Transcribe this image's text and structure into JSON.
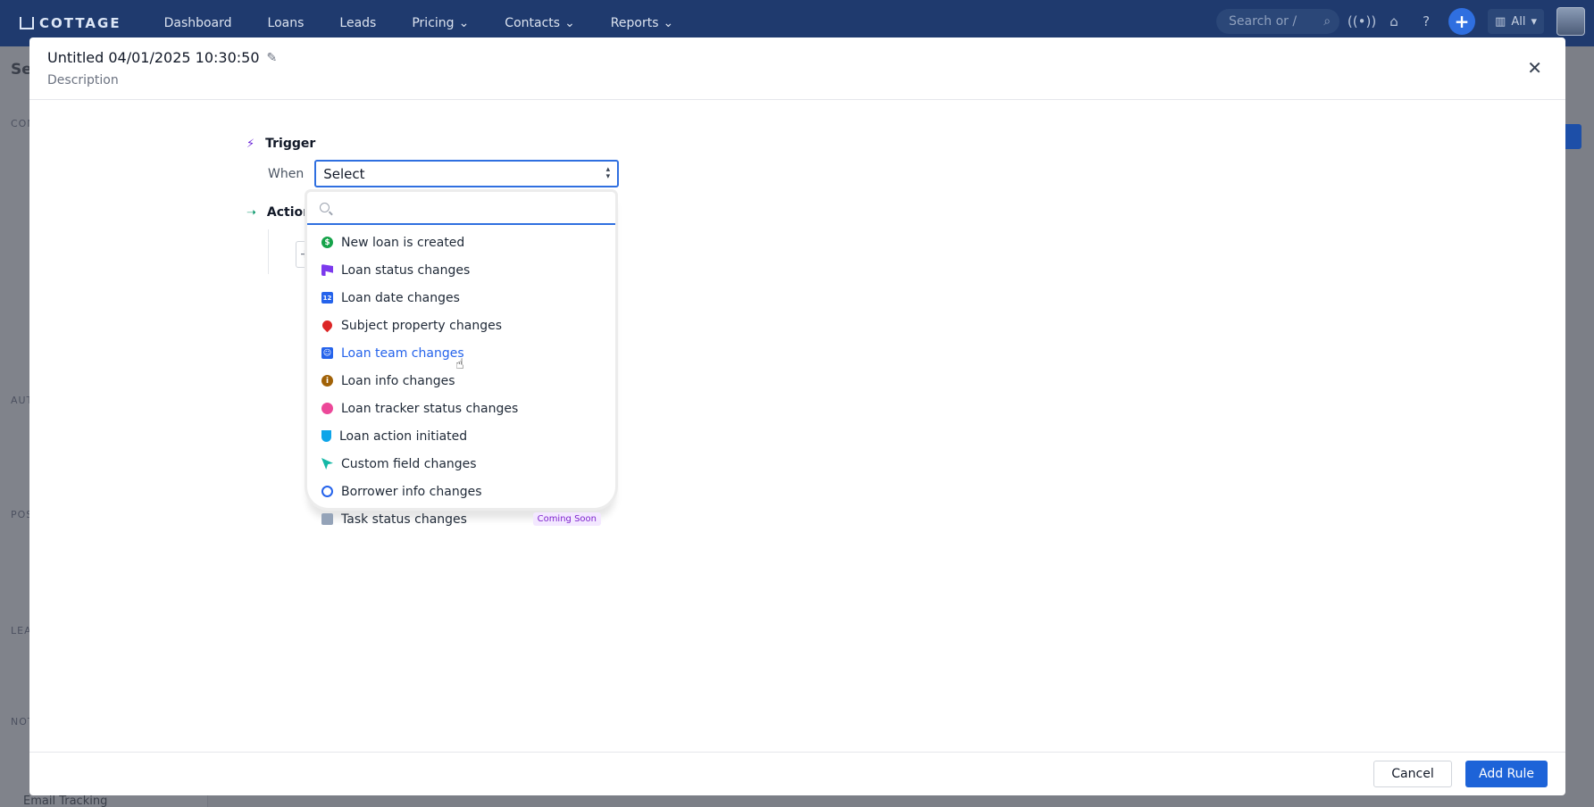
{
  "nav": {
    "logo": "COTTAGE",
    "items": [
      {
        "label": "Dashboard",
        "has_caret": false
      },
      {
        "label": "Loans",
        "has_caret": false
      },
      {
        "label": "Leads",
        "has_caret": false
      },
      {
        "label": "Pricing",
        "has_caret": true
      },
      {
        "label": "Contacts",
        "has_caret": true
      },
      {
        "label": "Reports",
        "has_caret": true
      }
    ],
    "search_placeholder": "Search or /",
    "scope_label": "All"
  },
  "background": {
    "page_title_fragment": "Se",
    "sections": [
      "CON",
      "AUT",
      "POS",
      "LEA",
      "NOT"
    ],
    "footer_link": "Email Tracking"
  },
  "modal": {
    "title": "Untitled 04/01/2025 10:30:50",
    "description": "Description",
    "trigger_label": "Trigger",
    "when_label": "When",
    "select_value": "Select",
    "actions_label": "Actions",
    "cancel_label": "Cancel",
    "add_rule_label": "Add Rule"
  },
  "dropdown": {
    "search_placeholder": "",
    "items": [
      {
        "label": "New loan is created",
        "icon": "dollar-icon",
        "color": "#16a34a"
      },
      {
        "label": "Loan status changes",
        "icon": "flag-icon",
        "color": "#7c3aed"
      },
      {
        "label": "Loan date changes",
        "icon": "calendar-icon",
        "color": "#2563eb"
      },
      {
        "label": "Subject property changes",
        "icon": "map-pin-icon",
        "color": "#dc2626"
      },
      {
        "label": "Loan team changes",
        "icon": "team-icon",
        "color": "#2563eb",
        "hovered": true
      },
      {
        "label": "Loan info changes",
        "icon": "info-icon",
        "color": "#a16207"
      },
      {
        "label": "Loan tracker status changes",
        "icon": "stopwatch-icon",
        "color": "#ec4899"
      },
      {
        "label": "Loan action initiated",
        "icon": "hand-pointer-icon",
        "color": "#0ea5e9"
      },
      {
        "label": "Custom field changes",
        "icon": "cursor-icon",
        "color": "#14b8a6"
      },
      {
        "label": "Borrower info changes",
        "icon": "user-circle-icon",
        "color": "#2563eb"
      },
      {
        "label": "Task status changes",
        "icon": "clipboard-icon",
        "color": "#94a3b8",
        "badge": "Coming Soon"
      }
    ]
  },
  "colors": {
    "accent": "#2f6fe0",
    "primary_button": "#1d63d8",
    "nav_bg": "#1f3a6e",
    "badge_text": "#7e22ce",
    "badge_bg": "#f3e8ff"
  }
}
